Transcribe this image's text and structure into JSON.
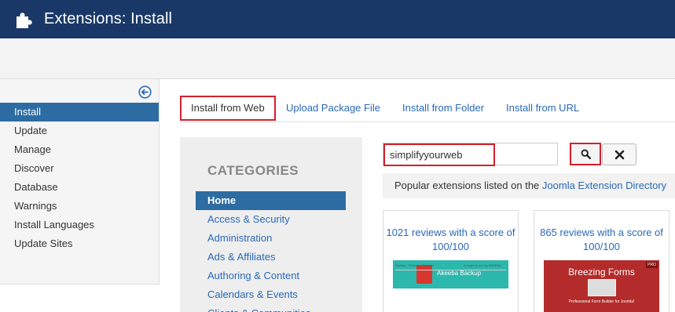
{
  "header": {
    "title": "Extensions: Install",
    "icon": "puzzle-icon"
  },
  "sidebar": {
    "collapse_icon": "arrow-left-circle-icon",
    "items": [
      {
        "label": "Install",
        "active": true
      },
      {
        "label": "Update"
      },
      {
        "label": "Manage"
      },
      {
        "label": "Discover"
      },
      {
        "label": "Database"
      },
      {
        "label": "Warnings"
      },
      {
        "label": "Install Languages"
      },
      {
        "label": "Update Sites"
      }
    ]
  },
  "tabs": [
    {
      "label": "Install from Web",
      "active": true
    },
    {
      "label": "Upload Package File"
    },
    {
      "label": "Install from Folder"
    },
    {
      "label": "Install from URL"
    }
  ],
  "categories": {
    "title": "CATEGORIES",
    "items": [
      {
        "label": "Home",
        "active": true
      },
      {
        "label": "Access & Security"
      },
      {
        "label": "Administration"
      },
      {
        "label": "Ads & Affiliates"
      },
      {
        "label": "Authoring & Content"
      },
      {
        "label": "Calendars & Events"
      },
      {
        "label": "Clients & Communities"
      }
    ]
  },
  "search": {
    "value": "simplifyyourweb",
    "search_icon": "search-icon",
    "clear_icon": "close-icon"
  },
  "popular": {
    "prefix": "Popular extensions listed on the ",
    "link": "Joomla Extension Directory"
  },
  "cards": [
    {
      "reviews": "1021 reviews with a score of 100/100",
      "thumb_name": "Akeeba Backup",
      "thumb_left": "Backup · Restore · Transfer",
      "thumb_right": "brought to you by AKEEBA"
    },
    {
      "reviews": "865 reviews with a score of 100/100",
      "thumb_name": "Breezing Forms",
      "thumb_tagline": "Professional Form Builder for Joomla!",
      "thumb_badge": "PRO"
    }
  ],
  "colors": {
    "header_bg": "#1a3867",
    "link": "#2a69b8",
    "active_bg": "#2d6ca2",
    "highlight": "#d21f2c"
  }
}
